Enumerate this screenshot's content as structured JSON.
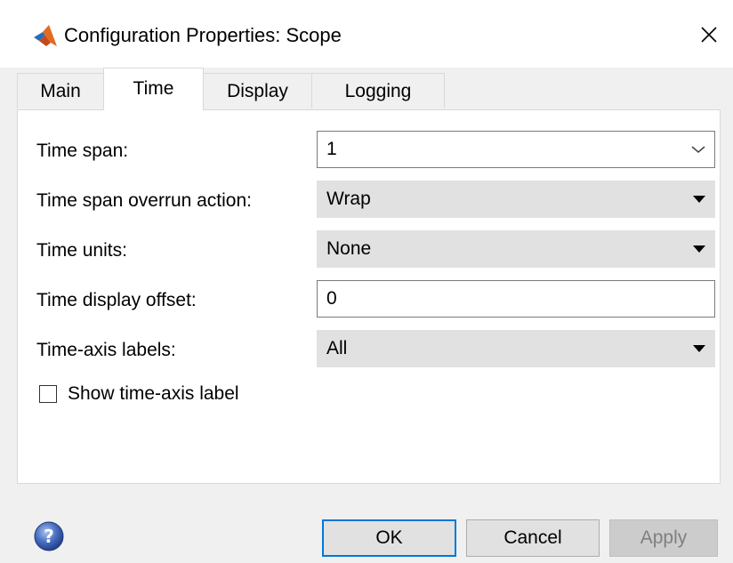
{
  "window": {
    "title": "Configuration Properties: Scope",
    "app_icon": "matlab-logo-icon",
    "close_icon": "close-icon"
  },
  "tabs": [
    {
      "label": "Main",
      "active": false
    },
    {
      "label": "Time",
      "active": true
    },
    {
      "label": "Display",
      "active": false
    },
    {
      "label": "Logging",
      "active": false
    }
  ],
  "fields": {
    "time_span": {
      "label": "Time span:",
      "value": "1",
      "kind": "editable-combo"
    },
    "overrun_action": {
      "label": "Time span overrun action:",
      "value": "Wrap",
      "kind": "select"
    },
    "time_units": {
      "label": "Time units:",
      "value": "None",
      "kind": "select"
    },
    "display_offset": {
      "label": "Time display offset:",
      "value": "0",
      "kind": "text"
    },
    "axis_labels": {
      "label": "Time-axis labels:",
      "value": "All",
      "kind": "select"
    }
  },
  "show_axis_label": {
    "label": "Show time-axis label",
    "checked": false
  },
  "buttons": {
    "ok": "OK",
    "cancel": "Cancel",
    "apply": "Apply",
    "apply_enabled": false
  },
  "help_icon": "help-icon",
  "colors": {
    "focus_border": "#0078d7",
    "dialog_bg": "#f0f0f0",
    "select_bg": "#e1e1e1",
    "help_blue": "#3b5fb0"
  }
}
